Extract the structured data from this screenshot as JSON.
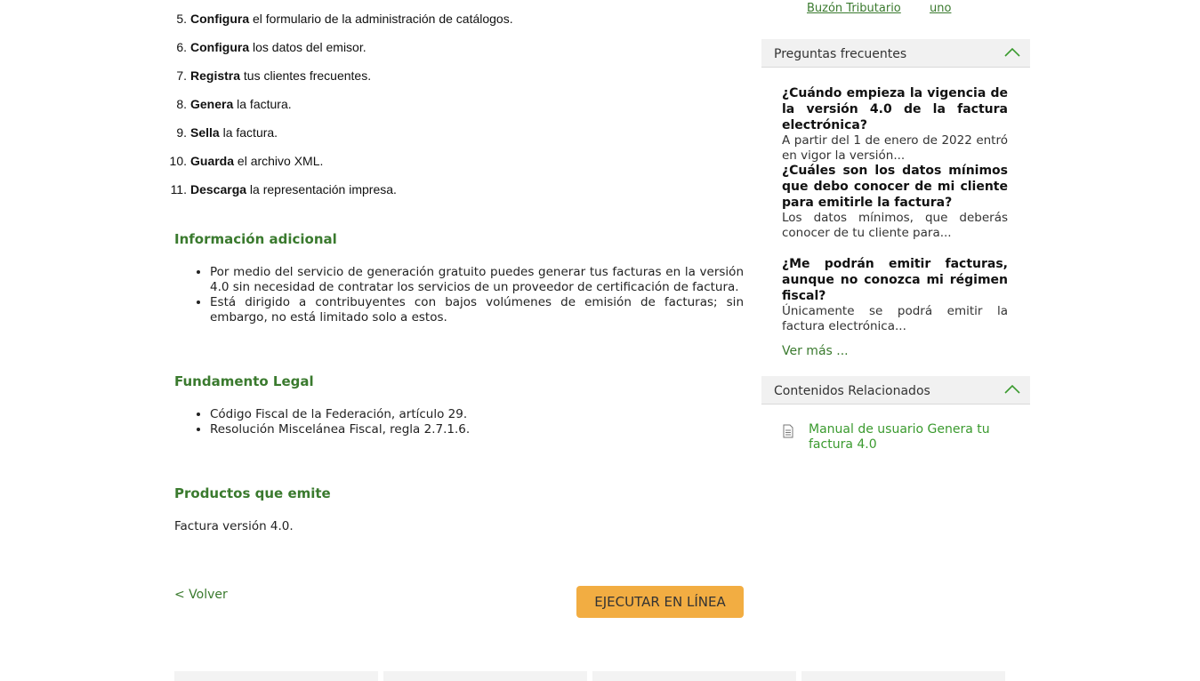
{
  "steps": [
    {
      "num": "5.",
      "bold": "Configura",
      "rest": " el formulario de la administración de catálogos."
    },
    {
      "num": "6.",
      "bold": "Configura",
      "rest": " los datos del emisor."
    },
    {
      "num": "7.",
      "bold": "Registra",
      "rest": " tus clientes frecuentes."
    },
    {
      "num": "8.",
      "bold": "Genera",
      "rest": " la factura."
    },
    {
      "num": "9.",
      "bold": "Sella",
      "rest": " la factura."
    },
    {
      "num": "10.",
      "bold": "Guarda",
      "rest": " el archivo XML."
    },
    {
      "num": "11.",
      "bold": "Descarga",
      "rest": " la representación impresa."
    }
  ],
  "info": {
    "title": "Información adicional",
    "items": [
      "Por medio del servicio de generación gratuito puedes generar tus facturas en la versión 4.0 sin necesidad de contratar los servicios de un proveedor de certificación de factura.",
      "Está dirigido a contribuyentes con bajos volúmenes de emisión de facturas; sin embargo, no está limitado solo a estos."
    ]
  },
  "legal": {
    "title": "Fundamento Legal",
    "items": [
      "Código Fiscal de la Federación, artículo 29.",
      "Resolución Miscelánea Fiscal, regla 2.7.1.6."
    ]
  },
  "products": {
    "title": "Productos que emite",
    "text": "Factura versión 4.0."
  },
  "actions": {
    "back": "< Volver",
    "run": "EJECUTAR EN LÍNEA"
  },
  "sidebar": {
    "top_left": "Buzón Tributario",
    "top_right": "uno",
    "faq_title": "Preguntas frecuentes",
    "faqs": [
      {
        "q": "¿Cuándo empieza la vigencia de la versión 4.0 de la factura electrónica?",
        "a": "A partir del 1 de enero de 2022 entró en vigor la versión..."
      },
      {
        "q": "¿Cuáles son los datos mínimos que debo conocer de mi cliente para emitirle la factura?",
        "a": "Los datos mínimos, que deberás conocer de tu cliente para..."
      },
      {
        "q": "¿Me podrán emitir facturas, aunque no conozca mi régimen fiscal?",
        "a": "Únicamente se podrá emitir la factura electrónica..."
      }
    ],
    "more": "Ver más ...",
    "related_title": "Contenidos Relacionados",
    "related_link": "Manual de usuario Genera tu factura 4.0",
    "accent": "#3a7a2e",
    "button_color": "#f2ad42"
  }
}
